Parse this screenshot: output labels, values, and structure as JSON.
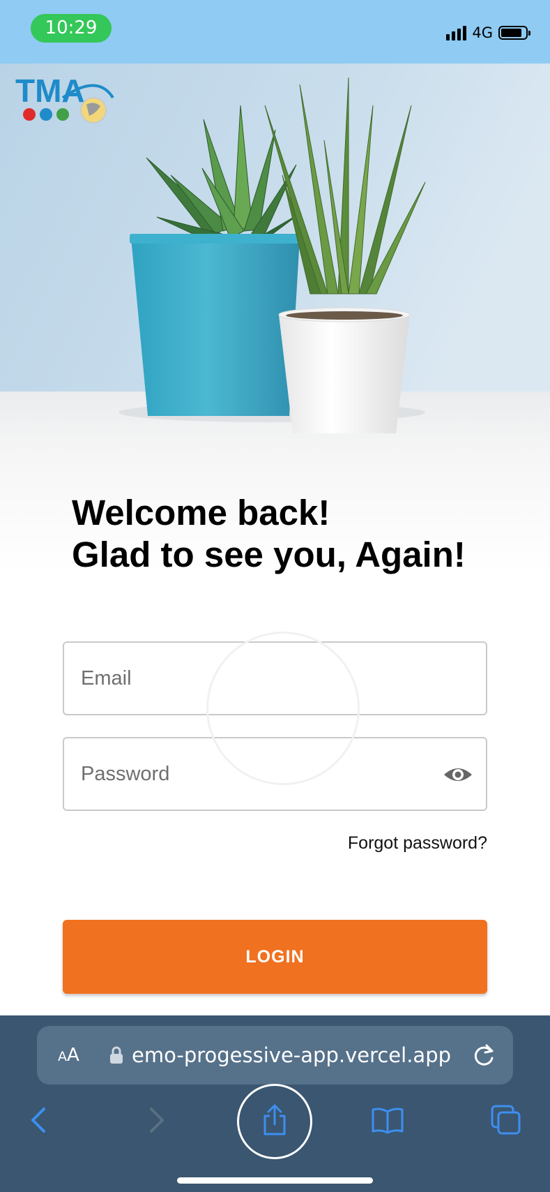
{
  "status_bar": {
    "time": "10:29",
    "network": "4G",
    "battery_level": 0.85
  },
  "brand": {
    "logo_text": "TMA",
    "accent": "#f07120"
  },
  "login": {
    "heading_line1": "Welcome back!",
    "heading_line2": "Glad to see you, Again!",
    "email_placeholder": "Email",
    "password_placeholder": "Password",
    "forgot_password": "Forgot password?",
    "login_button": "LOGIN"
  },
  "browser": {
    "text_size_label": "AA",
    "url": "emo-progessive-app.vercel.app",
    "toolbar_icons": [
      "back-icon",
      "forward-icon",
      "share-icon",
      "bookmarks-icon",
      "tabs-icon"
    ]
  }
}
